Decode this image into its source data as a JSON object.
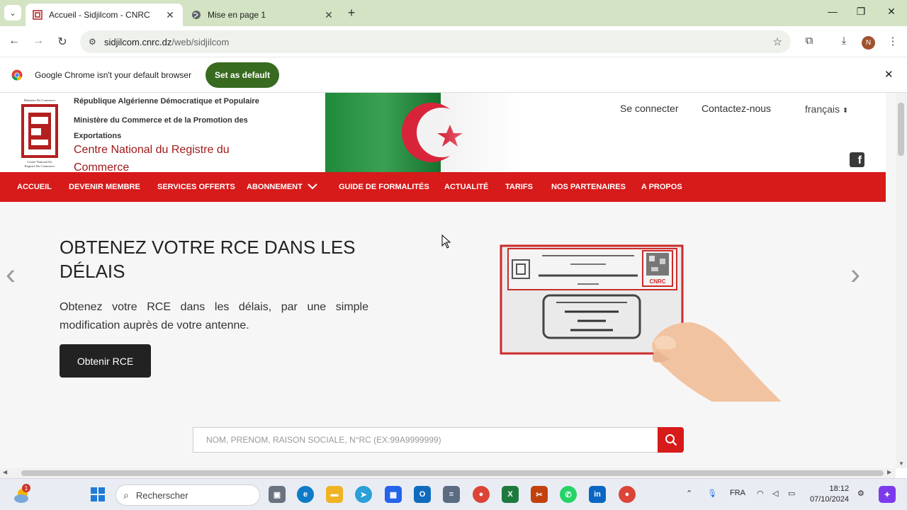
{
  "browser": {
    "tabs": [
      {
        "title": "Accueil - Sidjilcom - CNRC",
        "active": true
      },
      {
        "title": "Mise en page 1",
        "active": false
      }
    ],
    "url_host": "sidjilcom.cnrc.dz",
    "url_path": "/web/sidjilcom",
    "profile_initial": "N"
  },
  "infobar": {
    "message": "Google Chrome isn't your default browser",
    "button": "Set as default"
  },
  "header": {
    "line1": "République Algérienne Démocratique et Populaire",
    "line2": "Ministère du Commerce et de la Promotion des Exportations",
    "line3": "Centre National du Registre du Commerce",
    "logo_text_top": "Ministère Du Commerce",
    "logo_text_bottom": "Centre National Du Registre Du Commerce",
    "links": [
      "Se connecter",
      "Contactez-nous"
    ],
    "language": "français",
    "facebook": "f"
  },
  "nav": {
    "items": [
      "ACCUEIL",
      "DEVENIR MEMBRE",
      "SERVICES OFFERTS",
      "ABONNEMENT",
      "GUIDE DE FORMALITÉS",
      "ACTUALITÉ",
      "TARIFS",
      "NOS PARTENAIRES",
      "A PROPOS"
    ]
  },
  "hero": {
    "title": "OBTENEZ VOTRE RCE DANS LES DÉLAIS",
    "text": "Obtenez votre RCE dans les délais, par une simple modification auprès de votre antenne.",
    "button": "Obtenir RCE",
    "card_badge": "CNRC"
  },
  "search": {
    "placeholder": "NOM, PRENOM, RAISON SOCIALE, N°RC (EX:99A9999999)"
  },
  "taskbar": {
    "search_label": "Recherscher",
    "weather_badge": "1",
    "language": "FRA",
    "time": "18:12",
    "date": "07/10/2024"
  },
  "colors": {
    "brand_red": "#d71a1a",
    "chrome_green": "#386a20",
    "tabstrip": "#d3e3c4"
  }
}
